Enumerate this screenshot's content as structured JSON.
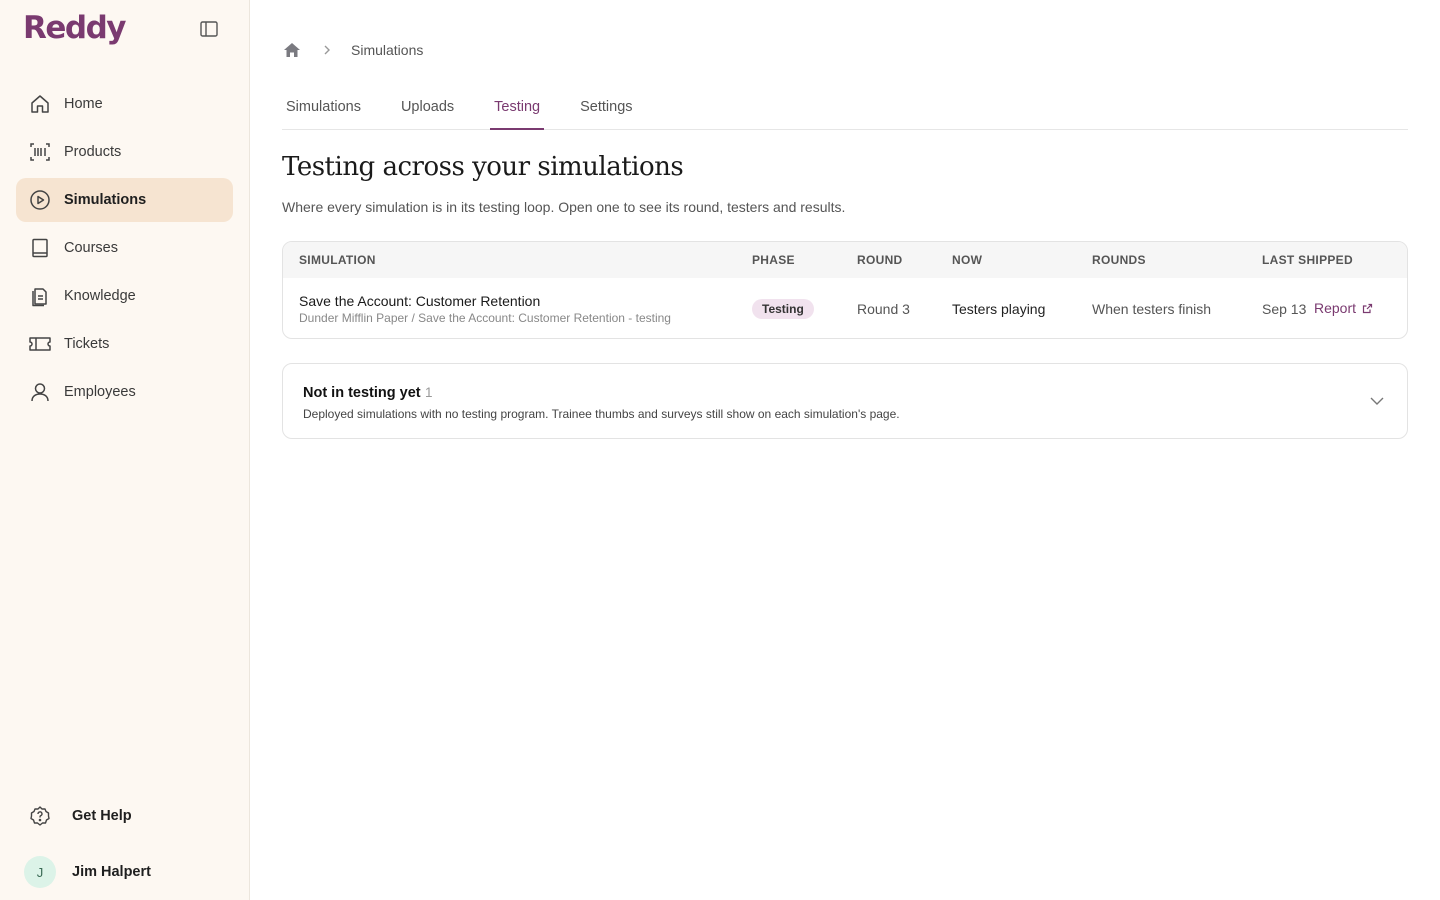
{
  "app": {
    "logo": "Reddy"
  },
  "sidebar": {
    "items": [
      {
        "label": "Home",
        "icon": "home-icon",
        "active": false
      },
      {
        "label": "Products",
        "icon": "barcode-icon",
        "active": false
      },
      {
        "label": "Simulations",
        "icon": "play-circle-icon",
        "active": true
      },
      {
        "label": "Courses",
        "icon": "book-icon",
        "active": false
      },
      {
        "label": "Knowledge",
        "icon": "document-icon",
        "active": false
      },
      {
        "label": "Tickets",
        "icon": "ticket-icon",
        "active": false
      },
      {
        "label": "Employees",
        "icon": "user-icon",
        "active": false
      }
    ],
    "help_label": "Get Help",
    "user": {
      "initial": "J",
      "name": "Jim Halpert"
    }
  },
  "breadcrumb": {
    "current": "Simulations"
  },
  "tabs": [
    {
      "label": "Simulations",
      "active": false
    },
    {
      "label": "Uploads",
      "active": false
    },
    {
      "label": "Testing",
      "active": true
    },
    {
      "label": "Settings",
      "active": false
    }
  ],
  "page": {
    "title": "Testing across your simulations",
    "subtitle": "Where every simulation is in its testing loop. Open one to see its round, testers and results."
  },
  "table": {
    "columns": [
      "SIMULATION",
      "PHASE",
      "ROUND",
      "NOW",
      "ROUNDS",
      "LAST SHIPPED"
    ],
    "rows": [
      {
        "name": "Save the Account: Customer Retention",
        "path": "Dunder Mifflin Paper / Save the Account: Customer Retention - testing",
        "phase": "Testing",
        "round": "Round 3",
        "now": "Testers playing",
        "rounds": "When testers finish",
        "last_shipped": "Sep 13",
        "report_label": "Report"
      }
    ]
  },
  "not_in_testing": {
    "title": "Not in testing yet",
    "count": "1",
    "description": "Deployed simulations with no testing program. Trainee thumbs and surveys still show on each simulation's page."
  },
  "colors": {
    "accent": "#7a3a70",
    "sidebar_bg": "#fdf8f2",
    "active_nav_bg": "#f6e4d1",
    "badge_bg": "#f1e2ee"
  }
}
